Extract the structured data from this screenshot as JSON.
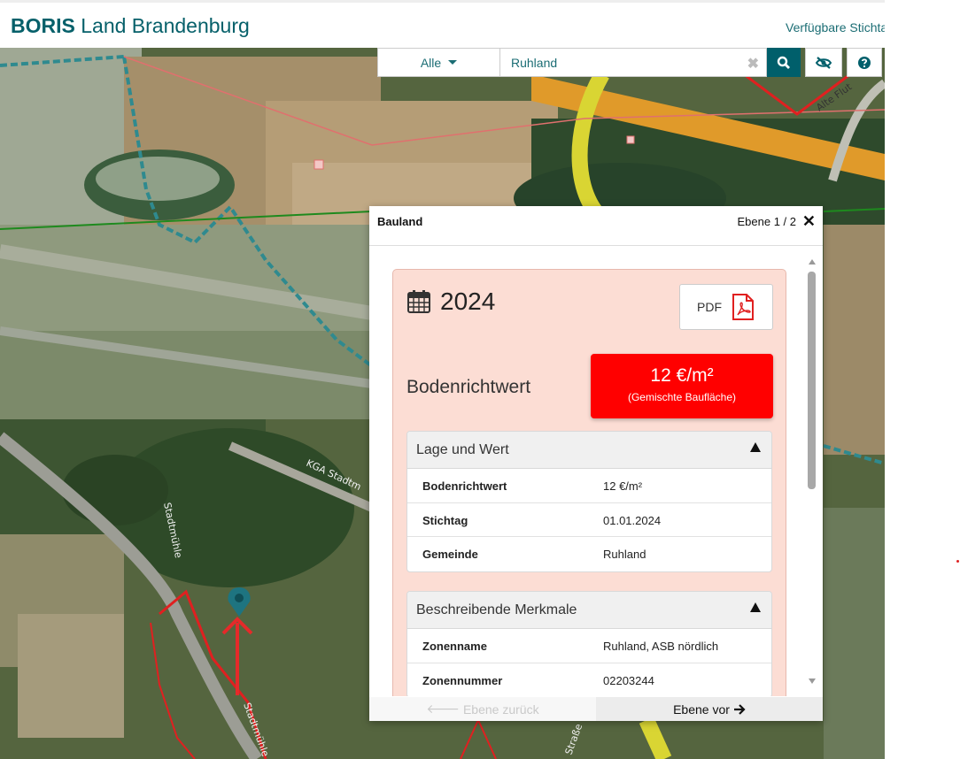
{
  "header": {
    "brand_bold": "BORIS",
    "brand_rest": " Land Brandenburg",
    "stichtag_link": "Verfügbare Stichta"
  },
  "search": {
    "filter_label": "Alle",
    "query": "Ruhland",
    "clear_glyph": "✖"
  },
  "map": {
    "labels": {
      "alte_flut": "Alte Flut",
      "kga": "KGA Stadtm",
      "stadtmuehle_1": "Stadtmühle",
      "stadtmuehle_2": "Stadtmühle",
      "strasse": "Straße"
    }
  },
  "popup": {
    "title": "Bauland",
    "level": "Ebene 1 / 2",
    "close_glyph": "✕",
    "year": "2024",
    "pdf_label": "PDF",
    "brw_label": "Bodenrichtwert",
    "value_main": "12 €/m²",
    "value_sub": "(Gemischte Baufläche)",
    "sections": [
      {
        "title": "Lage und Wert",
        "rows": [
          {
            "k": "Bodenrichtwert",
            "v": "12 €/m²"
          },
          {
            "k": "Stichtag",
            "v": "01.01.2024"
          },
          {
            "k": "Gemeinde",
            "v": "Ruhland"
          }
        ]
      },
      {
        "title": "Beschreibende Merkmale",
        "rows": [
          {
            "k": "Zonenname",
            "v": "Ruhland, ASB nördlich"
          },
          {
            "k": "Zonennummer",
            "v": "02203244"
          }
        ]
      }
    ],
    "nav_prev": "Ebene zurück",
    "nav_next": "Ebene vor"
  },
  "colors": {
    "brand": "#06606a",
    "value_badge": "#ff0000",
    "card_bg": "#fcddd4"
  },
  "icons": [
    "calendar-icon",
    "pdf-file-icon",
    "search-icon",
    "eye-slash-icon",
    "help-icon",
    "close-icon",
    "map-pin-icon",
    "arrow-left-icon",
    "arrow-right-icon"
  ]
}
